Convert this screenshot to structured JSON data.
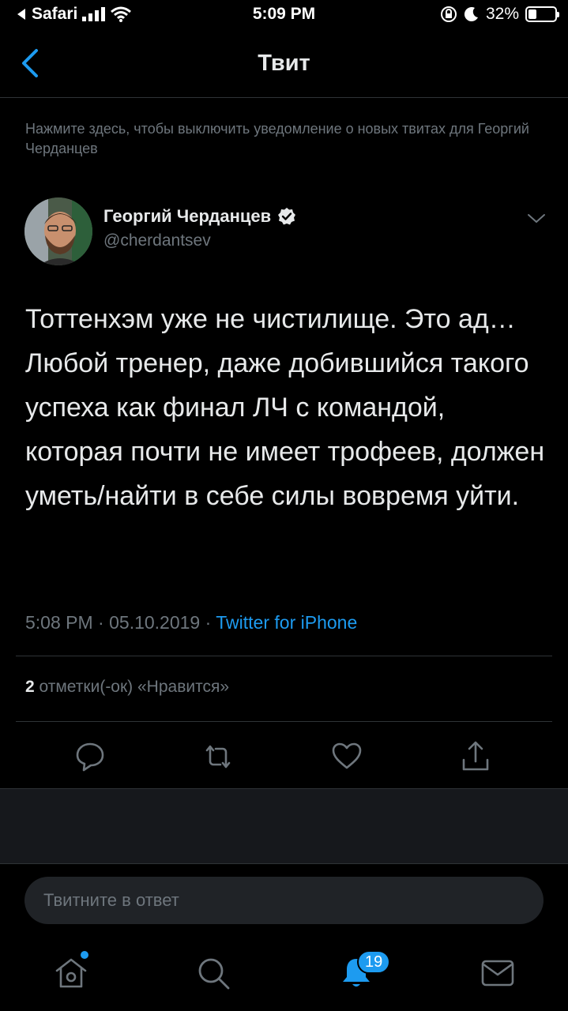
{
  "status_bar": {
    "carrier": "Safari",
    "time": "5:09 PM",
    "battery": "32%",
    "battery_level": 0.32,
    "icons": [
      "back-arrow-icon",
      "signal-icon",
      "wifi-icon",
      "rotation-lock-icon",
      "moon-icon",
      "battery-icon"
    ]
  },
  "nav": {
    "title": "Твит"
  },
  "notice": {
    "text": "Нажмите здесь, чтобы выключить уведомление о новых твитах для Георгий Черданцев"
  },
  "tweet": {
    "author_name": "Георгий Черданцев",
    "handle": "@cherdantsev",
    "text": "Тоттенхэм уже не чистилище. Это ад… Любой тренер, даже добившийся такого успеха как финал ЛЧ с командой, которая почти не имеет трофеев, должен уметь/найти в себе силы вовремя уйти.",
    "time": "5:08 PM",
    "dot1": "·",
    "date": "05.10.2019",
    "dot2": "·",
    "source": "Twitter for iPhone",
    "likes_count": "2",
    "likes_label": "отметки(-ок) «Нравится»"
  },
  "reply": {
    "placeholder": "Твитните в ответ"
  },
  "tabbar": {
    "notifications_badge": "19",
    "items": [
      "home-icon",
      "search-icon",
      "notifications-icon",
      "messages-icon"
    ]
  },
  "colors": {
    "accent": "#1d9bf0",
    "background": "#000000",
    "secondary_text": "#6e767d"
  }
}
